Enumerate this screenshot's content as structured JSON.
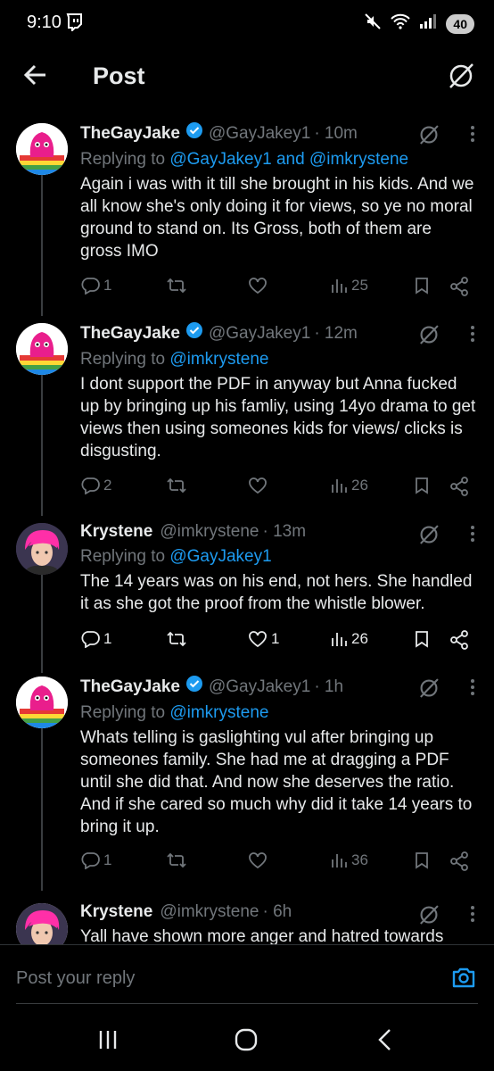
{
  "status_bar": {
    "time": "9:10",
    "battery": "40"
  },
  "header": {
    "title": "Post"
  },
  "tweets": [
    {
      "name": "TheGayJake",
      "verified": true,
      "handle": "@GayJakey1",
      "time": "· 10m",
      "replying_prefix": "Replying to ",
      "replying_to": "@GayJakey1 and @imkrystene",
      "text": "Again i was with it till she brought in his kids. And we all know she's only doing it for views, so ye no moral ground to stand on. Its Gross, both of them are gross IMO",
      "replies": "1",
      "likes": "",
      "views": "25",
      "bright": false
    },
    {
      "name": "TheGayJake",
      "verified": true,
      "handle": "@GayJakey1",
      "time": "· 12m",
      "replying_prefix": "Replying to ",
      "replying_to": "@imkrystene",
      "text": "I dont support the PDF in anyway but Anna fucked up by bringing up his famliy, using 14yo drama to get views then using someones kids for views/ clicks is disgusting.",
      "replies": "2",
      "likes": "",
      "views": "26",
      "bright": false
    },
    {
      "name": "Krystene",
      "verified": false,
      "handle": "@imkrystene",
      "time": "· 13m",
      "replying_prefix": "Replying to ",
      "replying_to": "@GayJakey1",
      "text": "The 14 years was on his end, not hers. She handled it as she got the proof from the whistle blower.",
      "replies": "1",
      "likes": "1",
      "views": "26",
      "bright": true
    },
    {
      "name": "TheGayJake",
      "verified": true,
      "handle": "@GayJakey1",
      "time": "· 1h",
      "replying_prefix": "Replying to ",
      "replying_to": "@imkrystene",
      "text": "Whats telling is gaslighting vul after bringing up someones family. She had me at dragging a PDF until she did that. And now she deserves the ratio. And if she cared so much why did it take 14 years to bring it up.",
      "replies": "1",
      "likes": "",
      "views": "36",
      "bright": false
    },
    {
      "name": "Krystene",
      "verified": false,
      "handle": "@imkrystene",
      "time": "· 6h",
      "text": "Yall have shown more anger and hatred towards"
    }
  ],
  "reply_box": {
    "placeholder": "Post your reply"
  },
  "colors": {
    "accent": "#1d9bf0",
    "background": "#000000",
    "muted": "#71767b"
  },
  "icons": [
    "back-arrow-icon",
    "grok-icon",
    "more-icon",
    "reply-icon",
    "repost-icon",
    "like-icon",
    "views-icon",
    "bookmark-icon",
    "share-icon",
    "camera-icon",
    "verified-badge-icon"
  ]
}
